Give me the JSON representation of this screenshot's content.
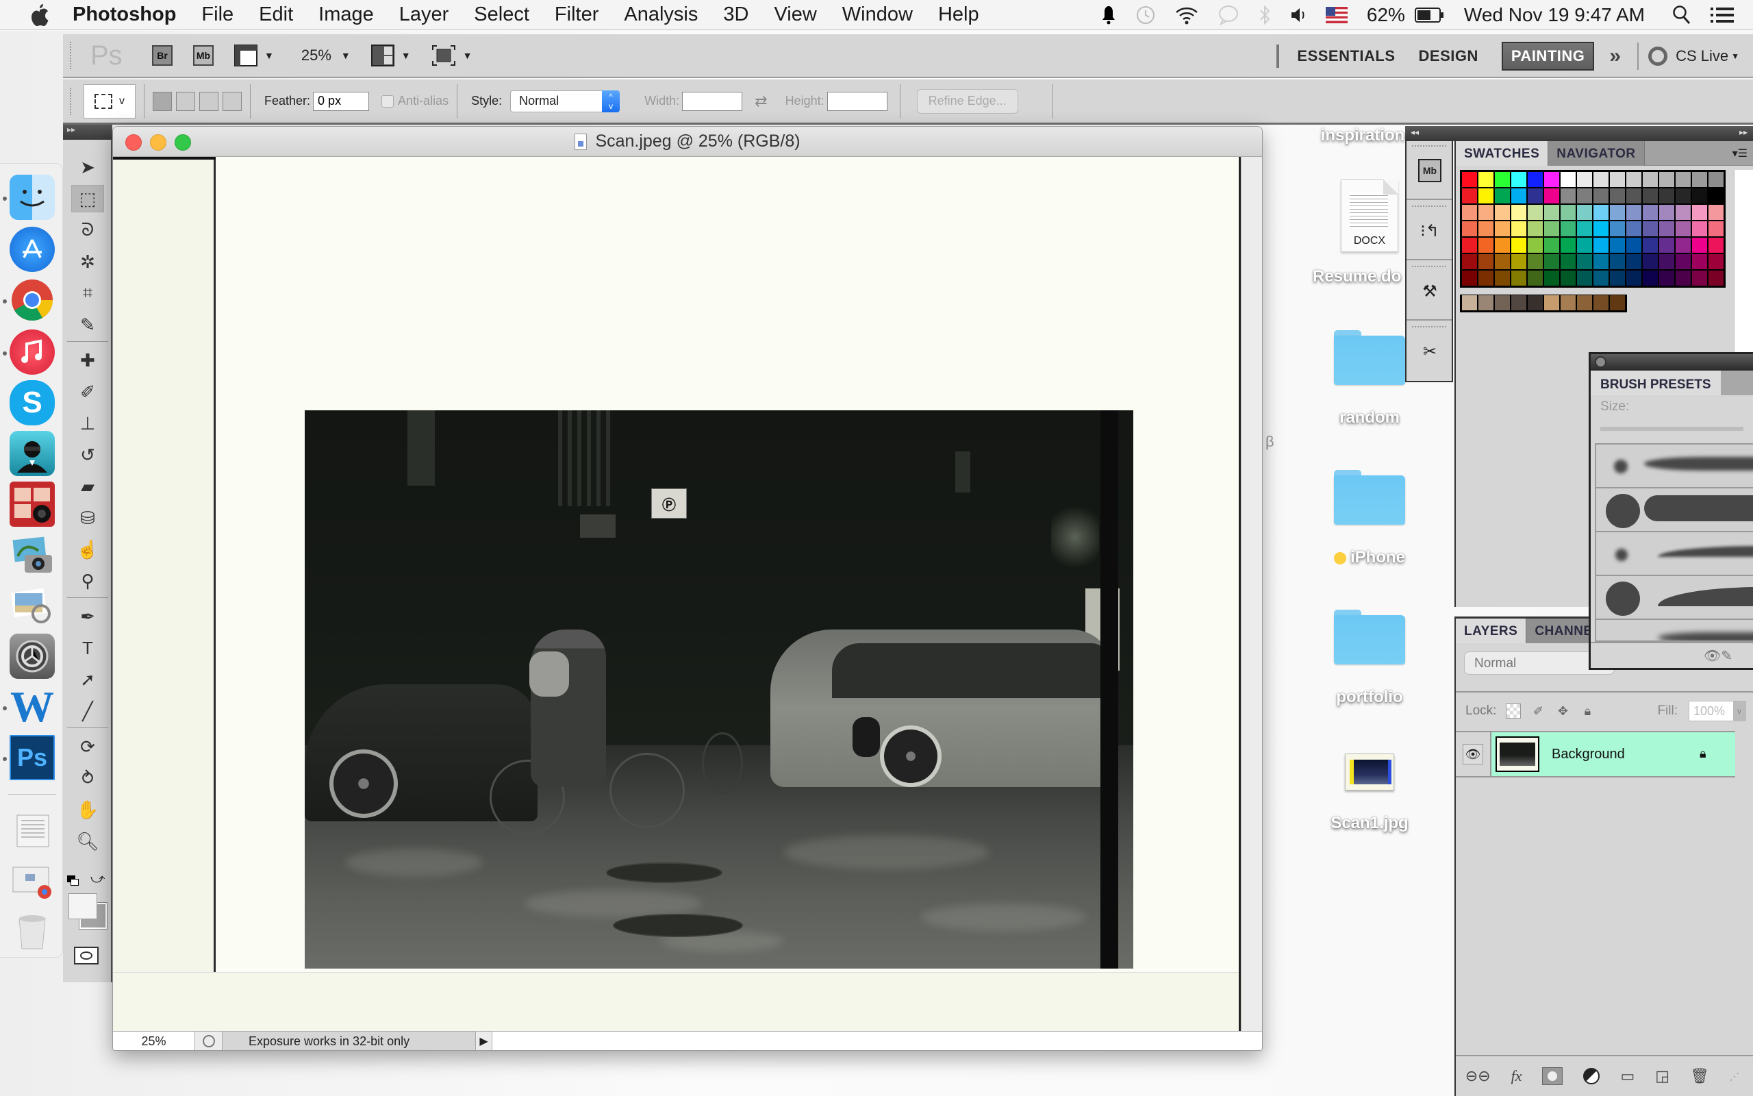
{
  "menubar": {
    "app_name": "Photoshop",
    "items": [
      "File",
      "Edit",
      "Image",
      "Layer",
      "Select",
      "Filter",
      "Analysis",
      "3D",
      "View",
      "Window",
      "Help"
    ],
    "status": {
      "battery_percent": "62%",
      "datetime": "Wed Nov 19  9:47 AM",
      "icons": [
        "notification-bell-icon",
        "time-machine-icon",
        "wifi-icon",
        "messages-icon",
        "bluetooth-icon",
        "volume-icon",
        "us-flag-input-icon",
        "battery-icon",
        "spotlight-icon",
        "notification-center-icon"
      ]
    }
  },
  "dock": {
    "apps": [
      {
        "name": "Finder",
        "running": true,
        "color": "#3a8ee6"
      },
      {
        "name": "App Store",
        "running": false,
        "color": "#2a8af0"
      },
      {
        "name": "Chrome",
        "running": true,
        "color": "#e8e8e8"
      },
      {
        "name": "iTunes",
        "running": true,
        "color": "#e8323f"
      },
      {
        "name": "Skype",
        "running": false,
        "color": "#12a7e8"
      },
      {
        "name": "Agent app",
        "running": false,
        "color": "#2b9fb8"
      },
      {
        "name": "Photo Booth",
        "running": false,
        "color": "#b3262a"
      },
      {
        "name": "Image Capture",
        "running": false,
        "color": "#6aa7c8"
      },
      {
        "name": "Preview",
        "running": false,
        "color": "#8ab3d6"
      },
      {
        "name": "System Preferences",
        "running": false,
        "color": "#777777"
      },
      {
        "name": "Word",
        "running": true,
        "color": "#1d7cd1"
      },
      {
        "name": "Photoshop",
        "running": true,
        "color": "#0c4e8e"
      }
    ],
    "ps_label": "Ps",
    "word_label": "W",
    "skype_label": "S",
    "stack_items": [
      "Documents stack",
      "Downloads stack",
      "Trash"
    ]
  },
  "appbar": {
    "logo": "Ps",
    "bridge_label": "Br",
    "minibridge_label": "Mb",
    "zoom": "25%",
    "workspaces": [
      "ESSENTIALS",
      "DESIGN",
      "PAINTING"
    ],
    "active_workspace": "PAINTING",
    "more": "»",
    "cs_live": "CS Live"
  },
  "options": {
    "feather_label": "Feather:",
    "feather_value": "0 px",
    "antialias_label": "Anti-alias",
    "style_label": "Style:",
    "style_value": "Normal",
    "width_label": "Width:",
    "width_value": "",
    "height_label": "Height:",
    "height_value": "",
    "refine_edge": "Refine Edge..."
  },
  "tools": [
    {
      "name": "move-tool",
      "glyph": "➤"
    },
    {
      "name": "rectangular-marquee-tool",
      "glyph": "⬚",
      "selected": true
    },
    {
      "name": "lasso-tool",
      "glyph": "ᘐ"
    },
    {
      "name": "quick-selection-tool",
      "glyph": "✲"
    },
    {
      "name": "crop-tool",
      "glyph": "⌗"
    },
    {
      "name": "eyedropper-tool",
      "glyph": "✎"
    },
    {
      "name": "spot-healing-brush-tool",
      "glyph": "✚"
    },
    {
      "name": "brush-tool",
      "glyph": "✐"
    },
    {
      "name": "clone-stamp-tool",
      "glyph": "⊥"
    },
    {
      "name": "history-brush-tool",
      "glyph": "↺"
    },
    {
      "name": "eraser-tool",
      "glyph": "▰"
    },
    {
      "name": "paint-bucket-tool",
      "glyph": "⛁"
    },
    {
      "name": "blur-tool",
      "glyph": "☝"
    },
    {
      "name": "dodge-tool",
      "glyph": "⚲"
    },
    {
      "name": "pen-tool",
      "glyph": "✒"
    },
    {
      "name": "type-tool",
      "glyph": "T"
    },
    {
      "name": "path-selection-tool",
      "glyph": "➚"
    },
    {
      "name": "line-tool",
      "glyph": "╱"
    },
    {
      "name": "3d-rotate-tool",
      "glyph": "⟳"
    },
    {
      "name": "3d-orbit-tool",
      "glyph": "⥁"
    },
    {
      "name": "hand-tool",
      "glyph": "✋"
    },
    {
      "name": "zoom-tool",
      "glyph": "🔍︎"
    }
  ],
  "document": {
    "title": "Scan.jpeg @ 25% (RGB/8)",
    "zoom": "25%",
    "status_message": "Exposure works in 32-bit only"
  },
  "desktop": {
    "items": [
      {
        "label": "inspiration",
        "type": "folder"
      },
      {
        "label": "Resume.do",
        "type": "docx",
        "badge": "DOCX"
      },
      {
        "label": "random",
        "type": "folder"
      },
      {
        "label": "iPhone",
        "type": "folder",
        "tag_color": "#fbcf3d"
      },
      {
        "label": "portfolio",
        "type": "folder"
      },
      {
        "label": "Scan1.jpg",
        "type": "image"
      }
    ]
  },
  "swatches": {
    "tabs": [
      "SWATCHES",
      "NAVIGATOR"
    ],
    "active_tab": "SWATCHES",
    "rows": [
      [
        "#ff0d1e",
        "#ffff33",
        "#29ff33",
        "#33ffff",
        "#1122ff",
        "#ff22ff",
        "#ffffff",
        "#ebebeb",
        "#e0e0e0",
        "#d6d6d6",
        "#cccccc",
        "#c0c0c0",
        "#b3b3b3",
        "#a6a6a6",
        "#9a9a9a",
        "#8d8d8d"
      ],
      [
        "#ed1c24",
        "#fff200",
        "#00a651",
        "#00aeef",
        "#2e3192",
        "#ec008c",
        "#898989",
        "#7d7d7d",
        "#707070",
        "#636363",
        "#555555",
        "#464646",
        "#363636",
        "#262626",
        "#111111",
        "#000000"
      ],
      [
        "#f7977a",
        "#f9ad81",
        "#fdc68a",
        "#fff79a",
        "#c4df9b",
        "#a3d39c",
        "#82ca9d",
        "#7bcdc8",
        "#6ecff6",
        "#7ea7d8",
        "#8493ca",
        "#8882be",
        "#a187be",
        "#bc8dbf",
        "#f49ac2",
        "#f5989d"
      ],
      [
        "#f26c4f",
        "#f68e55",
        "#fbaf5c",
        "#fff467",
        "#acd372",
        "#7cc576",
        "#3bb878",
        "#1abbb4",
        "#00bff3",
        "#438ccb",
        "#5574b9",
        "#605ca8",
        "#855fa8",
        "#a763a8",
        "#f06ea9",
        "#f26d7d"
      ],
      [
        "#ed1c24",
        "#f26522",
        "#f7941d",
        "#fff200",
        "#8dc73f",
        "#39b54a",
        "#00a651",
        "#00a99d",
        "#00aeef",
        "#0072bc",
        "#0054a6",
        "#2e3192",
        "#662d91",
        "#92278f",
        "#ec008c",
        "#ed145b"
      ],
      [
        "#9e0b0f",
        "#a0410d",
        "#a36209",
        "#aba000",
        "#598527",
        "#1a7b30",
        "#007236",
        "#00746b",
        "#0076a3",
        "#004b80",
        "#003471",
        "#1b1464",
        "#440e62",
        "#630460",
        "#9e005d",
        "#9e0039"
      ],
      [
        "#790000",
        "#7b2e00",
        "#7d4900",
        "#827b00",
        "#406618",
        "#005e20",
        "#005826",
        "#005952",
        "#005b7f",
        "#003663",
        "#002157",
        "#0d004c",
        "#32004b",
        "#4b0049",
        "#7b0046",
        "#7a0026"
      ]
    ],
    "last_row": [
      "#c7b299",
      "#998675",
      "#736357",
      "#534741",
      "#37302d",
      "#c69c6d",
      "#a67c52",
      "#8c6239",
      "#754c24",
      "#603913"
    ]
  },
  "brush_presets": {
    "tab": "BRUSH PRESETS",
    "size_label": "Size:"
  },
  "layers": {
    "tabs": [
      "LAYERS",
      "CHANNELS"
    ],
    "active_tab": "LAYERS",
    "blend_mode": "Normal",
    "lock_label": "Lock:",
    "fill_label": "Fill:",
    "fill_value": "100%",
    "items": [
      {
        "name": "Background",
        "visible": true,
        "locked": true,
        "selected": true,
        "highlight": "#a9f8d6"
      }
    ],
    "footer_icons": [
      "link-layers-icon",
      "fx-icon",
      "add-mask-icon",
      "adjustment-layer-icon",
      "new-group-icon",
      "new-layer-icon",
      "delete-layer-icon"
    ]
  }
}
